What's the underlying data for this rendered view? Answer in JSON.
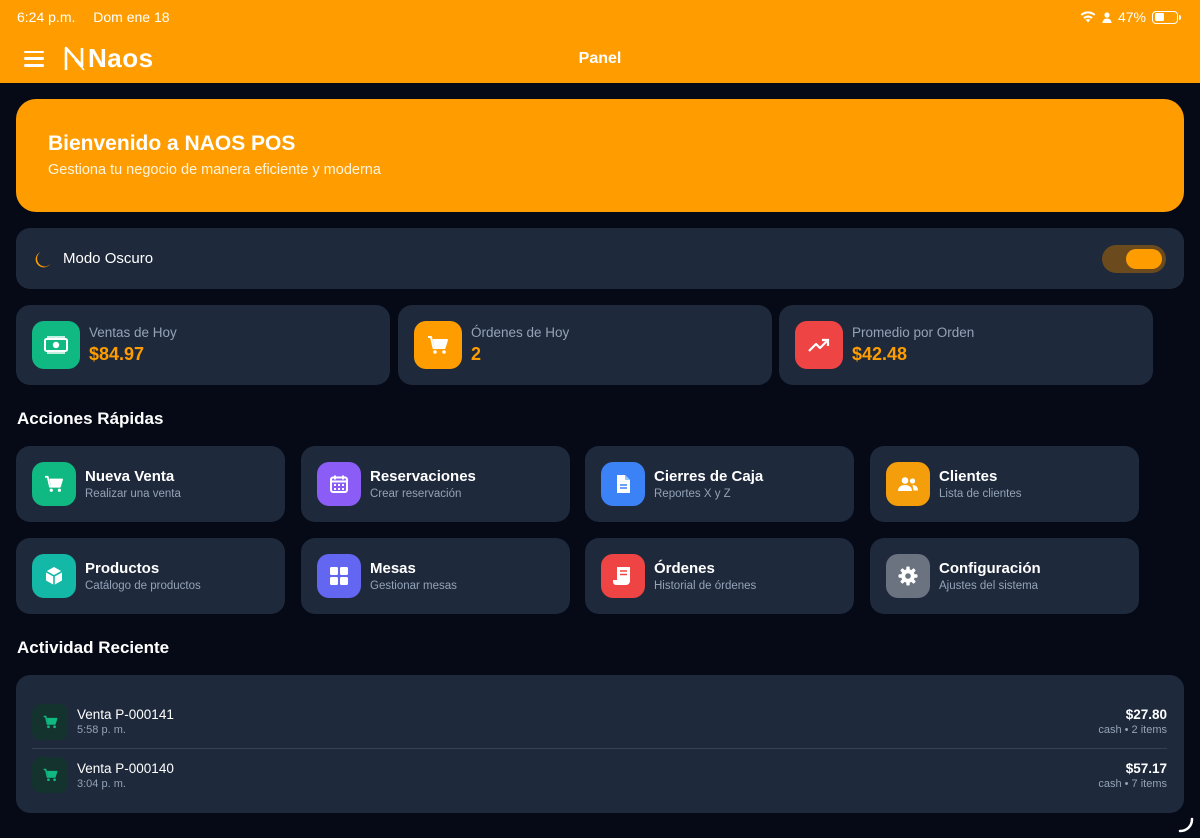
{
  "status": {
    "time": "6:24 p.m.",
    "date": "Dom ene 18",
    "battery": "47%"
  },
  "appbar": {
    "logo": "Naos",
    "title": "Panel"
  },
  "banner": {
    "title": "Bienvenido a NAOS POS",
    "subtitle": "Gestiona tu negocio de manera eficiente y moderna"
  },
  "dark_mode": {
    "label": "Modo Oscuro",
    "enabled": true
  },
  "stats": [
    {
      "title": "Ventas de Hoy",
      "value": "$84.97",
      "icon": "cash-icon",
      "color": "#10b981"
    },
    {
      "title": "Órdenes de Hoy",
      "value": "2",
      "icon": "cart-icon",
      "color": "#ff9d00"
    },
    {
      "title": "Promedio por Orden",
      "value": "$42.48",
      "icon": "trending-up-icon",
      "color": "#ef4444"
    }
  ],
  "quick_actions": {
    "title": "Acciones Rápidas",
    "items": [
      {
        "title": "Nueva Venta",
        "subtitle": "Realizar una venta",
        "icon": "cart-icon",
        "color": "#10b981"
      },
      {
        "title": "Reservaciones",
        "subtitle": "Crear reservación",
        "icon": "calendar-icon",
        "color": "#8b5cf6"
      },
      {
        "title": "Cierres de Caja",
        "subtitle": "Reportes X y Z",
        "icon": "document-icon",
        "color": "#3b82f6"
      },
      {
        "title": "Clientes",
        "subtitle": "Lista de clientes",
        "icon": "users-icon",
        "color": "#f59e0b"
      },
      {
        "title": "Productos",
        "subtitle": "Catálogo de productos",
        "icon": "cube-icon",
        "color": "#14b8a6"
      },
      {
        "title": "Mesas",
        "subtitle": "Gestionar mesas",
        "icon": "grid-icon",
        "color": "#6366f1"
      },
      {
        "title": "Órdenes",
        "subtitle": "Historial de órdenes",
        "icon": "receipt-icon",
        "color": "#ef4444"
      },
      {
        "title": "Configuración",
        "subtitle": "Ajustes del sistema",
        "icon": "gear-icon",
        "color": "#6b7280"
      }
    ]
  },
  "recent_activity": {
    "title": "Actividad Reciente",
    "items": [
      {
        "title": "Venta P-000141",
        "time": "5:58 p. m.",
        "amount": "$27.80",
        "detail": "cash • 2 items"
      },
      {
        "title": "Venta P-000140",
        "time": "3:04 p. m.",
        "amount": "$57.17",
        "detail": "cash • 7 items"
      }
    ]
  }
}
